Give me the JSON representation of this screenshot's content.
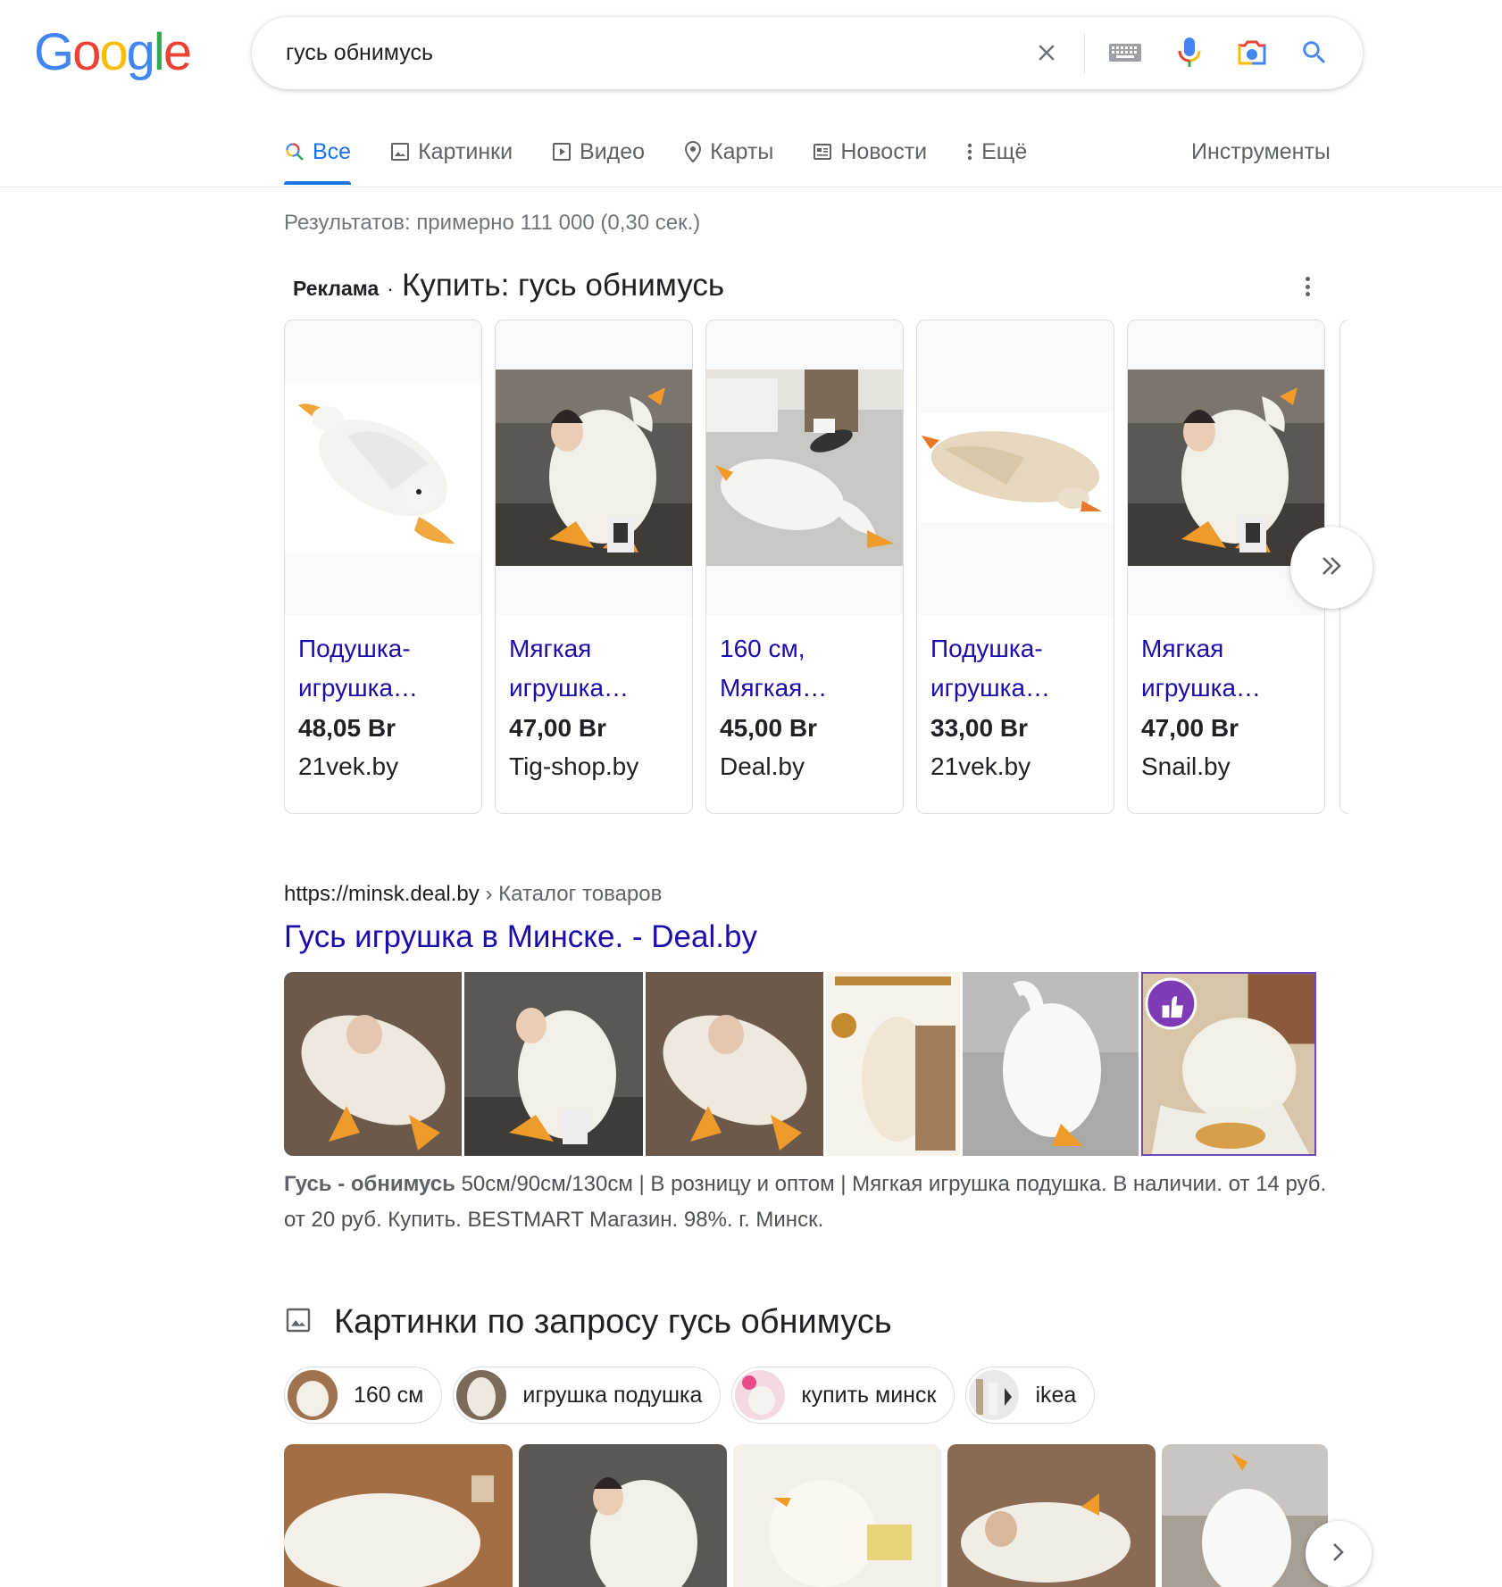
{
  "logo": {
    "letters": [
      "G",
      "o",
      "o",
      "g",
      "l",
      "e"
    ],
    "colors": [
      "#4285f4",
      "#ea4335",
      "#fbbc05",
      "#4285f4",
      "#34a853",
      "#ea4335"
    ]
  },
  "search": {
    "query": "гусь обнимусь",
    "icons": [
      "clear-icon",
      "keyboard-icon",
      "microphone-icon",
      "camera-icon",
      "search-icon"
    ]
  },
  "tabs": [
    {
      "label": "Все",
      "icon": "search-icon",
      "active": true
    },
    {
      "label": "Картинки",
      "icon": "image-icon"
    },
    {
      "label": "Видео",
      "icon": "video-icon"
    },
    {
      "label": "Карты",
      "icon": "map-pin-icon"
    },
    {
      "label": "Новости",
      "icon": "news-icon"
    },
    {
      "label": "Ещё",
      "icon": "more-vert-icon"
    }
  ],
  "tools_label": "Инструменты",
  "result_stats": "Результатов: примерно 111 000 (0,30 сек.)",
  "ads": {
    "label": "Реклама",
    "separator": "·",
    "title": "Купить: гусь обнимусь",
    "products": [
      {
        "name": "Подушка-игрушка…",
        "price": "48,05 Br",
        "store": "21vek.by"
      },
      {
        "name": "Мягкая игрушка…",
        "price": "47,00 Br",
        "store": "Tig-shop.by"
      },
      {
        "name": "160 см, Мягкая…",
        "price": "45,00 Br",
        "store": "Deal.by"
      },
      {
        "name": "Подушка-игрушка…",
        "price": "33,00 Br",
        "store": "21vek.by"
      },
      {
        "name": "Мягкая игрушка…",
        "price": "47,00 Br",
        "store": "Snail.by"
      }
    ]
  },
  "result": {
    "url": "https://minsk.deal.by",
    "breadcrumb": "› Каталог товаров",
    "title": "Гусь игрушка в Минске. - Deal.by",
    "snippet_bold": "Гусь - обнимусь",
    "snippet": " 50см/90см/130см | В розницу и оптом | Мягкая игрушка подушка. В наличии. от 14 руб. от 20 руб. Купить. BESTMART Магазин. 98%. г. Минск."
  },
  "images_section": {
    "title": "Картинки по запросу гусь обнимусь",
    "chips": [
      "160 см",
      "игрушка подушка",
      "купить минск",
      "ikea"
    ]
  }
}
